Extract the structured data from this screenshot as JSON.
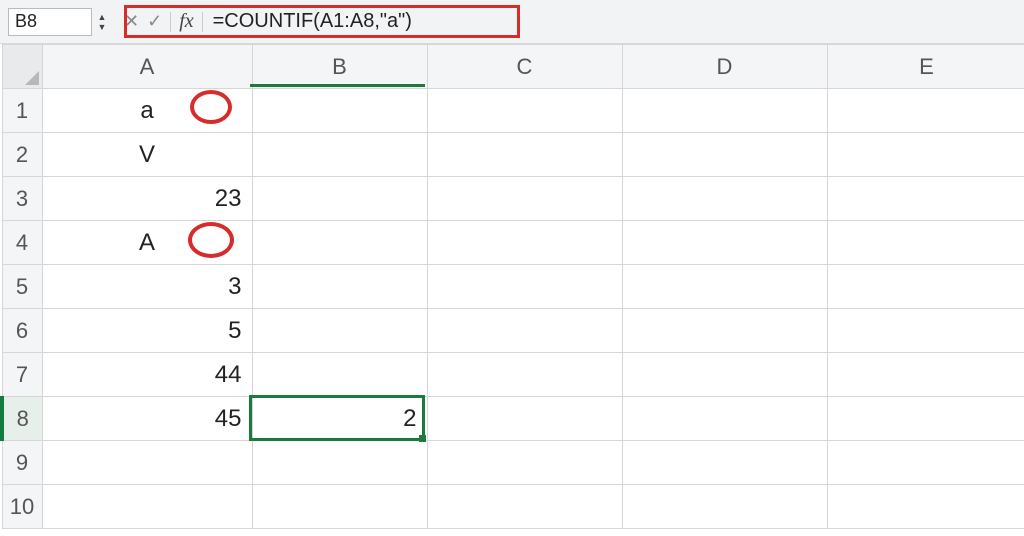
{
  "nameBox": {
    "value": "B8"
  },
  "formulaBar": {
    "cancel_glyph": "✕",
    "enter_glyph": "✓",
    "fx_label": "fx",
    "formula": "=COUNTIF(A1:A8,\"a\")"
  },
  "columns": [
    "A",
    "B",
    "C",
    "D",
    "E"
  ],
  "rows": [
    "1",
    "2",
    "3",
    "4",
    "5",
    "6",
    "7",
    "8",
    "9",
    "10"
  ],
  "cells": {
    "A1": {
      "v": "a",
      "t": "text"
    },
    "A2": {
      "v": "V",
      "t": "text"
    },
    "A3": {
      "v": "23",
      "t": "num"
    },
    "A4": {
      "v": "A",
      "t": "text"
    },
    "A5": {
      "v": "3",
      "t": "num"
    },
    "A6": {
      "v": "5",
      "t": "num"
    },
    "A7": {
      "v": "44",
      "t": "num"
    },
    "A8": {
      "v": "45",
      "t": "num"
    },
    "B8": {
      "v": "2",
      "t": "num"
    }
  },
  "activeCell": "B8",
  "annotations": {
    "circled_cells": [
      "A1",
      "A4"
    ],
    "highlight_formula_bar": true
  }
}
